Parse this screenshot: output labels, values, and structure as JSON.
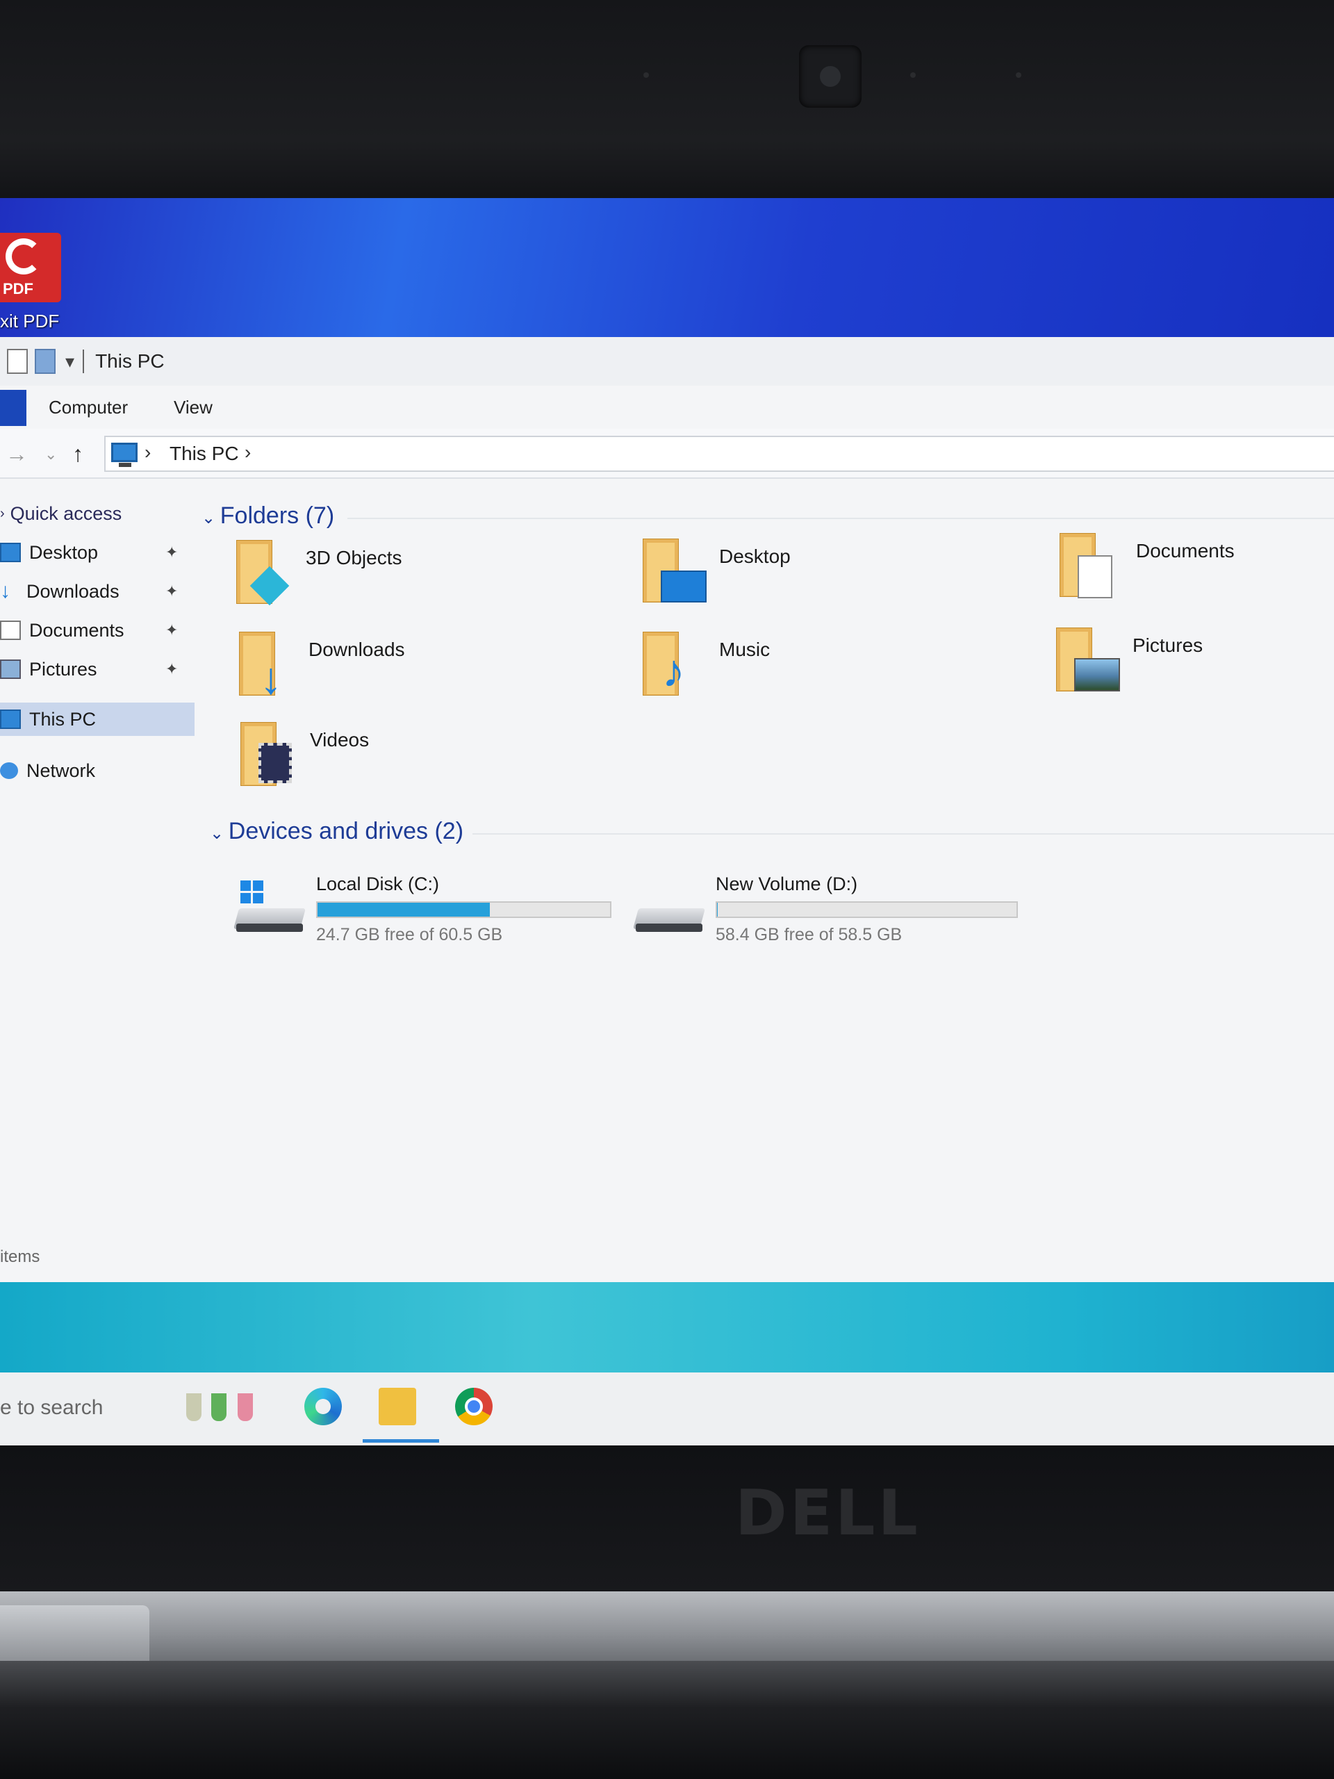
{
  "desktop": {
    "foxit_label": "xit PDF",
    "foxit_badge": "PDF"
  },
  "window": {
    "title": "This PC",
    "ribbon_tabs": [
      "Computer",
      "View"
    ]
  },
  "address": {
    "path": "This PC",
    "separator": "›"
  },
  "nav_pane": {
    "quick_access": "Quick access",
    "items": [
      {
        "label": "Desktop",
        "pinned": true
      },
      {
        "label": "Downloads",
        "pinned": true
      },
      {
        "label": "Documents",
        "pinned": true
      },
      {
        "label": "Pictures",
        "pinned": true
      }
    ],
    "this_pc": "This PC",
    "network": "Network"
  },
  "folders": {
    "header": "Folders (7)",
    "items": [
      "3D Objects",
      "Desktop",
      "Documents",
      "Downloads",
      "Music",
      "Pictures",
      "Videos"
    ]
  },
  "drives": {
    "header": "Devices and drives (2)",
    "items": [
      {
        "name": "Local Disk (C:)",
        "free_text": "24.7 GB free of 60.5 GB",
        "used_fraction": 0.59
      },
      {
        "name": "New Volume (D:)",
        "free_text": "58.4 GB free of 58.5 GB",
        "used_fraction": 0.002
      }
    ]
  },
  "status_bar": {
    "text": "items"
  },
  "taskbar": {
    "search_text": "e to search"
  },
  "laptop": {
    "brand": "DELL"
  }
}
